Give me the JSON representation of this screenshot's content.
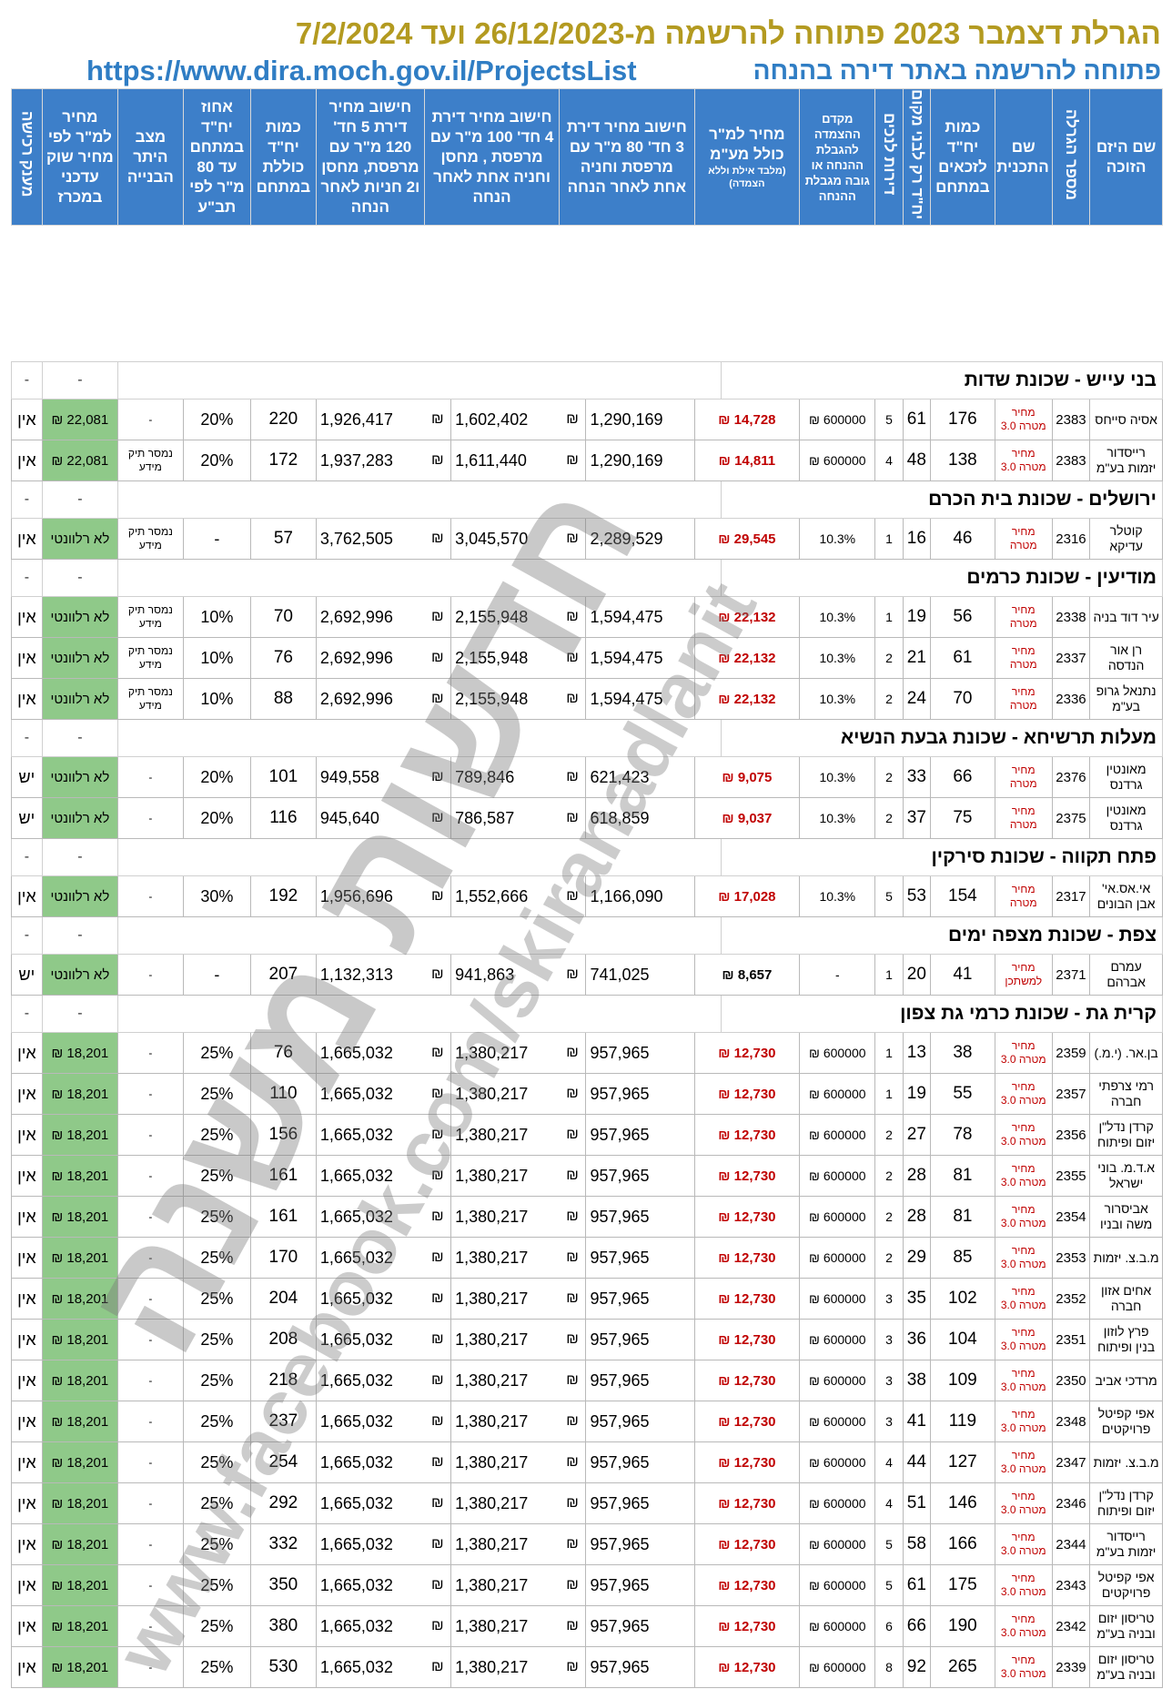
{
  "header": {
    "title": "הגרלת דצמבר 2023  פתוחה להרשמה מ-26/12/2023 ועד 7/2/2024",
    "subtitle": "פתוחה להרשמה באתר דירה בהנחה",
    "url": "https://www.dira.moch.gov.il/ProjectsList"
  },
  "columns": {
    "developer": "שם היזם הזוכה",
    "lottery_no": "מספר הגרלה",
    "plan_name": "שם התכנית",
    "units_eligible": "כמות יח\"ד לזכאים במתחם",
    "units_locals": "יח\"ד רק לבני מקום",
    "units_disabled": "דירות לנכים",
    "deposit": "מקדם ההצמדה להגבלת ההנחה או גובה מגבלת ההנחה",
    "price_per_sqm": "מחיר למ\"ר כולל מע\"מ",
    "price_per_sqm_note": "(מלבד אילת וללא הצמדה)",
    "calc3": "חישוב מחיר דירת 3 חד' 80 מ\"ר עם מרפסת וחניה אחת לאחר הנחה",
    "calc4": "חישוב מחיר דירת 4 חד' 100 מ\"ר עם מרפסת , מחסן וחניה אחת לאחר הנחה",
    "calc5": "חישוב מחיר דירת 5 חד' 120 מ\"ר עם מרפסת, מחסן ו2 חניות לאחר הנחה",
    "units_total": "כמות יח\"ד כוללת במתחם",
    "pct80": "אחוז יח\"ד במתחם עד 80 מ\"ר לפי תב\"ע",
    "status": "מצב היתר הבנייה",
    "market_price": "מחיר למ\"ר לפי מחיר שוק עדכני במכרז",
    "grant": "מענק רכישה"
  },
  "currency": "₪",
  "groups": [
    {
      "name": "בני עייש - שכונת שדות",
      "dash_market": "-",
      "dash_status": "-",
      "rows": [
        {
          "dev": "אסיה סייחס",
          "num": "2383",
          "type": "מחיר מטרה 3.0",
          "elig": "176",
          "local": "61",
          "dis": "5",
          "dep": "600000",
          "ppsqm": "14,728",
          "c3": "1,290,169",
          "c4": "1,602,402",
          "c5": "1,926,417",
          "total": "220",
          "pct": "20%",
          "status": "-",
          "market": "22,081",
          "grant": "אין"
        },
        {
          "dev": "רייסדור יזמות בע\"מ",
          "num": "2383",
          "type": "מחיר מטרה 3.0",
          "elig": "138",
          "local": "48",
          "dis": "4",
          "dep": "600000",
          "ppsqm": "14,811",
          "c3": "1,290,169",
          "c4": "1,611,440",
          "c5": "1,937,283",
          "total": "172",
          "pct": "20%",
          "status": "נמסר תיק מידע",
          "market": "22,081",
          "grant": "אין"
        }
      ]
    },
    {
      "name": "ירושלים - שכונת בית הכרם",
      "dash_market": "-",
      "dash_status": "-",
      "rows": [
        {
          "dev": "קוטלר עדיקא",
          "num": "2316",
          "type": "מחיר מטרה",
          "elig": "46",
          "local": "16",
          "dis": "1",
          "dep": "10.3%",
          "ppsqm": "29,545",
          "c3": "2,289,529",
          "c4": "3,045,570",
          "c5": "3,762,505",
          "total": "57",
          "pct": "-",
          "status": "נמסר תיק מידע",
          "market": "לא רלוונטי",
          "grant": "אין"
        }
      ]
    },
    {
      "name": "מודיעין - שכונת כרמים",
      "dash_market": "-",
      "dash_status": "-",
      "rows": [
        {
          "dev": "עיר דוד בניה",
          "num": "2338",
          "type": "מחיר מטרה",
          "elig": "56",
          "local": "19",
          "dis": "1",
          "dep": "10.3%",
          "ppsqm": "22,132",
          "c3": "1,594,475",
          "c4": "2,155,948",
          "c5": "2,692,996",
          "total": "70",
          "pct": "10%",
          "status": "נמסר תיק מידע",
          "market": "לא רלוונטי",
          "grant": "אין"
        },
        {
          "dev": "רן אור הנדסה",
          "num": "2337",
          "type": "מחיר מטרה",
          "elig": "61",
          "local": "21",
          "dis": "2",
          "dep": "10.3%",
          "ppsqm": "22,132",
          "c3": "1,594,475",
          "c4": "2,155,948",
          "c5": "2,692,996",
          "total": "76",
          "pct": "10%",
          "status": "נמסר תיק מידע",
          "market": "לא רלוונטי",
          "grant": "אין"
        },
        {
          "dev": "נתנאל גרופ בע\"מ",
          "num": "2336",
          "type": "מחיר מטרה",
          "elig": "70",
          "local": "24",
          "dis": "2",
          "dep": "10.3%",
          "ppsqm": "22,132",
          "c3": "1,594,475",
          "c4": "2,155,948",
          "c5": "2,692,996",
          "total": "88",
          "pct": "10%",
          "status": "נמסר תיק מידע",
          "market": "לא רלוונטי",
          "grant": "אין"
        }
      ]
    },
    {
      "name": "מעלות תרשיחא - שכונת גבעת הנשיא",
      "dash_market": "-",
      "dash_status": "-",
      "rows": [
        {
          "dev": "מאונטין גרדנס",
          "num": "2376",
          "type": "מחיר מטרה",
          "elig": "66",
          "local": "33",
          "dis": "2",
          "dep": "10.3%",
          "ppsqm": "9,075",
          "c3": "621,423",
          "c4": "789,846",
          "c5": "949,558",
          "total": "101",
          "pct": "20%",
          "status": "-",
          "market": "לא רלוונטי",
          "grant": "יש"
        },
        {
          "dev": "מאונטין גרדנס",
          "num": "2375",
          "type": "מחיר מטרה",
          "elig": "75",
          "local": "37",
          "dis": "2",
          "dep": "10.3%",
          "ppsqm": "9,037",
          "c3": "618,859",
          "c4": "786,587",
          "c5": "945,640",
          "total": "116",
          "pct": "20%",
          "status": "-",
          "market": "לא רלוונטי",
          "grant": "יש"
        }
      ]
    },
    {
      "name": "פתח תקווה - שכונת סירקין",
      "dash_market": "-",
      "dash_status": "-",
      "rows": [
        {
          "dev": "אי.אס.אי' אבן הבונים",
          "num": "2317",
          "type": "מחיר מטרה",
          "elig": "154",
          "local": "53",
          "dis": "5",
          "dep": "10.3%",
          "ppsqm": "17,028",
          "c3": "1,166,090",
          "c4": "1,552,666",
          "c5": "1,956,696",
          "total": "192",
          "pct": "30%",
          "status": "-",
          "market": "לא רלוונטי",
          "grant": "אין"
        }
      ]
    },
    {
      "name": "צפת - שכונת מצפה ימים",
      "dash_market": "-",
      "dash_status": "-",
      "rows": [
        {
          "dev": "עמרם אברהם",
          "num": "2371",
          "type": "מחיר למשתכן",
          "elig": "41",
          "local": "20",
          "dis": "1",
          "dep": "-",
          "ppsqm": "8,657",
          "black": true,
          "c3": "741,025",
          "c4": "941,863",
          "c5": "1,132,313",
          "total": "207",
          "pct": "-",
          "status": "-",
          "market": "לא רלוונטי",
          "grant": "יש"
        }
      ]
    },
    {
      "name": "קרית גת - שכונת כרמי גת צפון",
      "dash_market": "-",
      "dash_status": "-",
      "rows": [
        {
          "dev": "בן.אר. (י.מ.)",
          "num": "2359",
          "type": "מחיר מטרה 3.0",
          "elig": "38",
          "local": "13",
          "dis": "1",
          "dep": "600000",
          "ppsqm": "12,730",
          "c3": "957,965",
          "c4": "1,380,217",
          "c5": "1,665,032",
          "total": "76",
          "pct": "25%",
          "status": "-",
          "market": "18,201",
          "grant": "אין"
        },
        {
          "dev": "רמי צרפתי חברה",
          "num": "2357",
          "type": "מחיר מטרה 3.0",
          "elig": "55",
          "local": "19",
          "dis": "1",
          "dep": "600000",
          "ppsqm": "12,730",
          "c3": "957,965",
          "c4": "1,380,217",
          "c5": "1,665,032",
          "total": "110",
          "pct": "25%",
          "status": "-",
          "market": "18,201",
          "grant": "אין"
        },
        {
          "dev": "קרדן נדל\"ן יזום ופיתוח",
          "num": "2356",
          "type": "מחיר מטרה 3.0",
          "elig": "78",
          "local": "27",
          "dis": "2",
          "dep": "600000",
          "ppsqm": "12,730",
          "c3": "957,965",
          "c4": "1,380,217",
          "c5": "1,665,032",
          "total": "156",
          "pct": "25%",
          "status": "-",
          "market": "18,201",
          "grant": "אין"
        },
        {
          "dev": "א.ד.מ. בוני ישראל",
          "num": "2355",
          "type": "מחיר מטרה 3.0",
          "elig": "81",
          "local": "28",
          "dis": "2",
          "dep": "600000",
          "ppsqm": "12,730",
          "c3": "957,965",
          "c4": "1,380,217",
          "c5": "1,665,032",
          "total": "161",
          "pct": "25%",
          "status": "-",
          "market": "18,201",
          "grant": "אין"
        },
        {
          "dev": "אביסרור משה ובניו",
          "num": "2354",
          "type": "מחיר מטרה 3.0",
          "elig": "81",
          "local": "28",
          "dis": "2",
          "dep": "600000",
          "ppsqm": "12,730",
          "c3": "957,965",
          "c4": "1,380,217",
          "c5": "1,665,032",
          "total": "161",
          "pct": "25%",
          "status": "-",
          "market": "18,201",
          "grant": "אין"
        },
        {
          "dev": "מ.ב.צ. יזמות",
          "num": "2353",
          "type": "מחיר מטרה 3.0",
          "elig": "85",
          "local": "29",
          "dis": "2",
          "dep": "600000",
          "ppsqm": "12,730",
          "c3": "957,965",
          "c4": "1,380,217",
          "c5": "1,665,032",
          "total": "170",
          "pct": "25%",
          "status": "-",
          "market": "18,201",
          "grant": "אין"
        },
        {
          "dev": "אחים אזון חברה",
          "num": "2352",
          "type": "מחיר מטרה 3.0",
          "elig": "102",
          "local": "35",
          "dis": "3",
          "dep": "600000",
          "ppsqm": "12,730",
          "c3": "957,965",
          "c4": "1,380,217",
          "c5": "1,665,032",
          "total": "204",
          "pct": "25%",
          "status": "-",
          "market": "18,201",
          "grant": "אין"
        },
        {
          "dev": "פרץ לוזון בנין ופיתוח",
          "num": "2351",
          "type": "מחיר מטרה 3.0",
          "elig": "104",
          "local": "36",
          "dis": "3",
          "dep": "600000",
          "ppsqm": "12,730",
          "c3": "957,965",
          "c4": "1,380,217",
          "c5": "1,665,032",
          "total": "208",
          "pct": "25%",
          "status": "-",
          "market": "18,201",
          "grant": "אין"
        },
        {
          "dev": "מרדכי אביב",
          "num": "2350",
          "type": "מחיר מטרה 3.0",
          "elig": "109",
          "local": "38",
          "dis": "3",
          "dep": "600000",
          "ppsqm": "12,730",
          "c3": "957,965",
          "c4": "1,380,217",
          "c5": "1,665,032",
          "total": "218",
          "pct": "25%",
          "status": "-",
          "market": "18,201",
          "grant": "אין"
        },
        {
          "dev": "אפי קפיטל פרויקטים",
          "num": "2348",
          "type": "מחיר מטרה 3.0",
          "elig": "119",
          "local": "41",
          "dis": "3",
          "dep": "600000",
          "ppsqm": "12,730",
          "c3": "957,965",
          "c4": "1,380,217",
          "c5": "1,665,032",
          "total": "237",
          "pct": "25%",
          "status": "-",
          "market": "18,201",
          "grant": "אין"
        },
        {
          "dev": "מ.ב.צ. יזמות",
          "num": "2347",
          "type": "מחיר מטרה 3.0",
          "elig": "127",
          "local": "44",
          "dis": "4",
          "dep": "600000",
          "ppsqm": "12,730",
          "c3": "957,965",
          "c4": "1,380,217",
          "c5": "1,665,032",
          "total": "254",
          "pct": "25%",
          "status": "-",
          "market": "18,201",
          "grant": "אין"
        },
        {
          "dev": "קרדן נדל\"ן יזום ופיתוח",
          "num": "2346",
          "type": "מחיר מטרה 3.0",
          "elig": "146",
          "local": "51",
          "dis": "4",
          "dep": "600000",
          "ppsqm": "12,730",
          "c3": "957,965",
          "c4": "1,380,217",
          "c5": "1,665,032",
          "total": "292",
          "pct": "25%",
          "status": "-",
          "market": "18,201",
          "grant": "אין"
        },
        {
          "dev": "רייסדור יזמות בע\"מ",
          "num": "2344",
          "type": "מחיר מטרה 3.0",
          "elig": "166",
          "local": "58",
          "dis": "5",
          "dep": "600000",
          "ppsqm": "12,730",
          "c3": "957,965",
          "c4": "1,380,217",
          "c5": "1,665,032",
          "total": "332",
          "pct": "25%",
          "status": "-",
          "market": "18,201",
          "grant": "אין"
        },
        {
          "dev": "אפי קפיטל פרויקטים",
          "num": "2343",
          "type": "מחיר מטרה 3.0",
          "elig": "175",
          "local": "61",
          "dis": "5",
          "dep": "600000",
          "ppsqm": "12,730",
          "c3": "957,965",
          "c4": "1,380,217",
          "c5": "1,665,032",
          "total": "350",
          "pct": "25%",
          "status": "-",
          "market": "18,201",
          "grant": "אין"
        },
        {
          "dev": "טריסון יזום ובניה בע\"מ",
          "num": "2342",
          "type": "מחיר מטרה 3.0",
          "elig": "190",
          "local": "66",
          "dis": "6",
          "dep": "600000",
          "ppsqm": "12,730",
          "c3": "957,965",
          "c4": "1,380,217",
          "c5": "1,665,032",
          "total": "380",
          "pct": "25%",
          "status": "-",
          "market": "18,201",
          "grant": "אין"
        },
        {
          "dev": "טריסון יזום ובניה בע\"מ",
          "num": "2339",
          "type": "מחיר מטרה 3.0",
          "elig": "265",
          "local": "92",
          "dis": "8",
          "dep": "600000",
          "ppsqm": "12,730",
          "c3": "957,965",
          "c4": "1,380,217",
          "c5": "1,665,032",
          "total": "530",
          "pct": "25%",
          "status": "-",
          "market": "18,201",
          "grant": "אין"
        }
      ]
    }
  ],
  "watermark": {
    "main": "חדשות משנה",
    "url": "www.facebook.com/skiranadlanit"
  }
}
